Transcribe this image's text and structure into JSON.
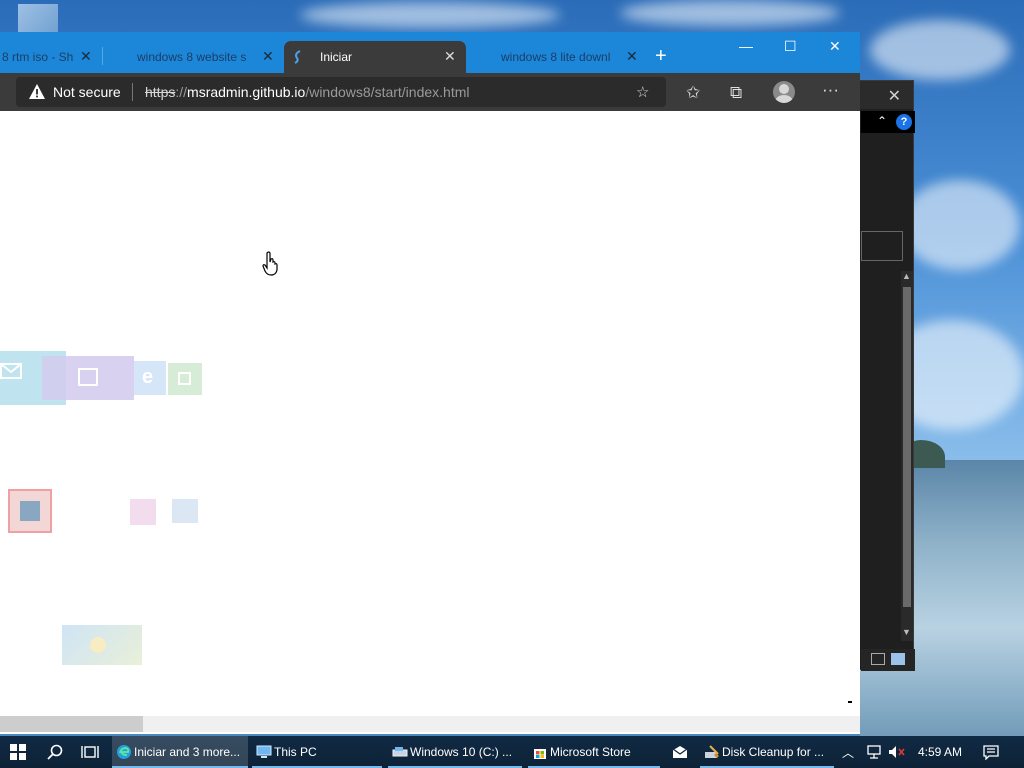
{
  "browser": {
    "tabs": [
      {
        "label": "8 rtm iso - Sh",
        "active": false
      },
      {
        "label": "windows 8 website s",
        "active": false
      },
      {
        "label": "Iniciar",
        "active": true
      },
      {
        "label": "windows 8 lite downl",
        "active": false
      }
    ],
    "new_tab": "+",
    "security_label": "Not secure",
    "url_protocol": "https",
    "url_sep": "://",
    "url_host": "msradmin.github.io",
    "url_path": "/windows8/start/index.html",
    "window_buttons": {
      "minimize": "—",
      "maximize": "☐",
      "close": "✕"
    }
  },
  "background_window": {
    "close": "✕",
    "help": "?"
  },
  "taskbar": {
    "apps": [
      {
        "label": "Iniciar and 3 more..."
      },
      {
        "label": "This PC"
      },
      {
        "label": "Windows 10 (C:) ..."
      },
      {
        "label": "Microsoft Store"
      },
      {
        "label": "Disk Cleanup for ..."
      }
    ],
    "time": "4:59 AM"
  },
  "colors": {
    "tab_strip": "#1c87d9",
    "toolbar": "#3b3b3b",
    "taskbar": "#0d2236"
  }
}
